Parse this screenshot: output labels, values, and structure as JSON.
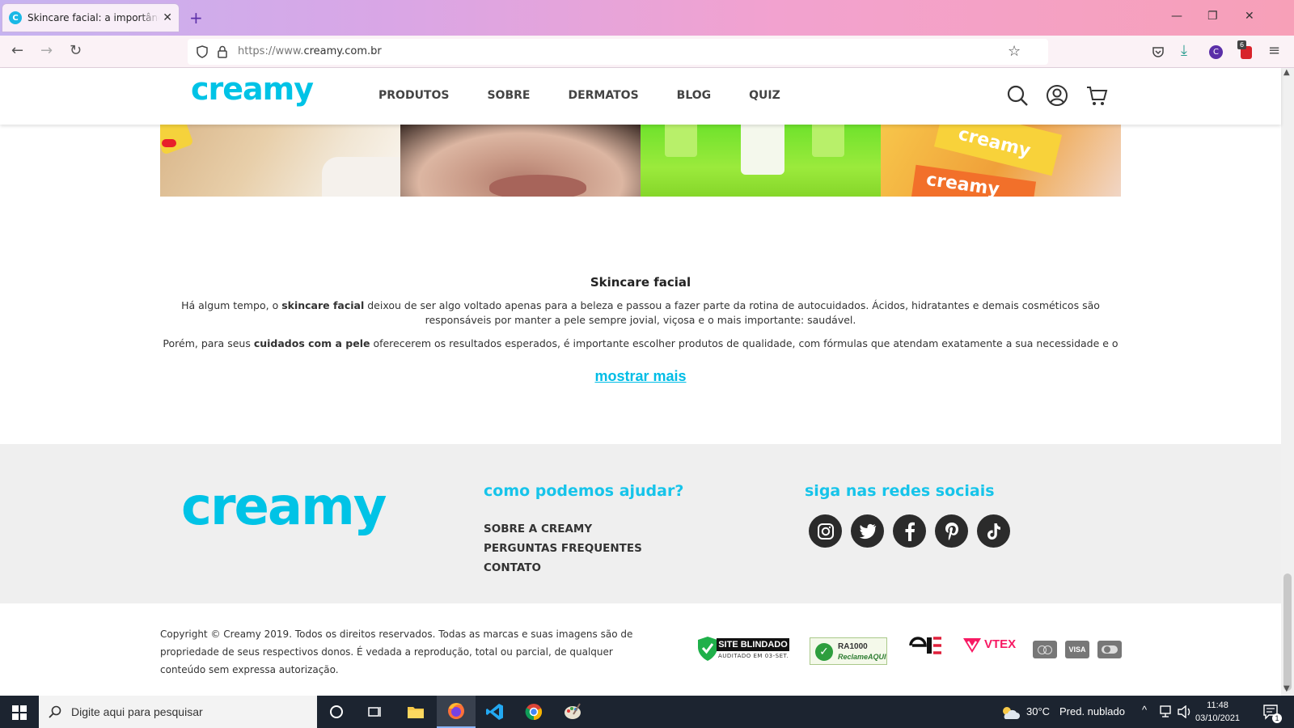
{
  "browser": {
    "tab_title": "Skincare facial: a importância de",
    "tab_favicon": "C",
    "url_prefix": "https://www.",
    "url_domain": "creamy.com.br",
    "extension_badge": "6"
  },
  "header": {
    "logo": "creamy",
    "menu": [
      "PRODUTOS",
      "SOBRE",
      "DERMATOS",
      "BLOG",
      "QUIZ"
    ]
  },
  "article": {
    "title": "Skincare facial",
    "p1_pre": "Há algum tempo, o ",
    "p1_bold": "skincare facial",
    "p1_post": " deixou de ser algo voltado apenas para a beleza e passou a fazer parte da rotina de autocuidados. Ácidos, hidratantes e demais cosméticos são responsáveis por manter a pele sempre jovial, viçosa e o mais importante: saudável.",
    "p2_pre": "Porém, para seus ",
    "p2_bold": "cuidados com a pele",
    "p2_post": " oferecerem os resultados esperados, é importante escolher produtos de qualidade, com fórmulas que atendam exatamente a sua necessidade e o seu tipo",
    "show_more": "mostrar mais",
    "banner_text": [
      "creamy",
      "creamy"
    ]
  },
  "footer": {
    "logo": "creamy",
    "help_heading": "como podemos ajudar?",
    "help_links": [
      "SOBRE A CREAMY",
      "PERGUNTAS FREQUENTES",
      "CONTATO"
    ],
    "social_heading": "siga nas redes sociais",
    "social": [
      "instagram-icon",
      "twitter-icon",
      "facebook-icon",
      "pinterest-icon",
      "tiktok-icon"
    ],
    "copyright": "Copyright © Creamy 2019. Todos os direitos reservados. Todas as marcas e suas imagens são de propriedade de seus respectivos donos. É vedada a reprodução, total ou parcial, de qualquer conteúdo sem expressa autorização.",
    "seals": {
      "site_blindado": "SITE BLINDADO",
      "site_blindado_sub": "AUDITADO EM 03-SET.",
      "ra1000": "RA1000",
      "reclame_aqui": "ReclameAQUI",
      "vtex": "VTEX",
      "visa": "VISA"
    }
  },
  "taskbar": {
    "search_placeholder": "Digite aqui para pesquisar",
    "weather_temp": "30°C",
    "weather_text": "Pred. nublado",
    "time": "11:48",
    "date": "03/10/2021",
    "notification_count": "1"
  },
  "colors": {
    "brand": "#00c3e6",
    "footer_bg": "#efefef",
    "taskbar": "#1c2430"
  }
}
